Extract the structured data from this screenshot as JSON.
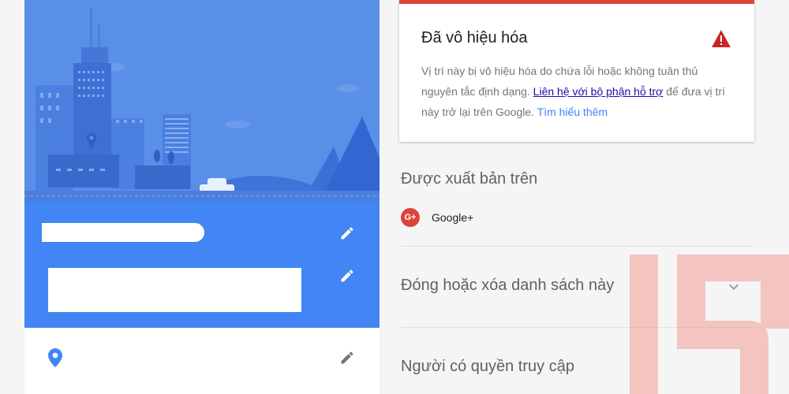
{
  "listing_card": {
    "name_redacted": true,
    "address_redacted": true
  },
  "alert": {
    "title": "Đã vô hiệu hóa",
    "body_prefix": "Vị trí này bị vô hiệu hóa do chứa lỗi hoặc không tuân thủ nguyên tắc định dạng. ",
    "support_link": "Liên hệ với bộ phận hỗ trợ",
    "body_suffix": " để đưa vị trí này trở lại trên Google. ",
    "learn_more_link": "Tìm hiểu thêm",
    "accent_color": "#db4437"
  },
  "published": {
    "title": "Được xuất bản trên",
    "platform_label": "Google+",
    "platform_icon": "G+"
  },
  "close_section": {
    "title": "Đóng hoặc xóa danh sách này",
    "icon": "chevron-down-icon"
  },
  "access_section": {
    "title": "Người có quyền truy cập"
  },
  "colors": {
    "primary_blue": "#4285f4",
    "hero_blue": "#5a8fe8",
    "alert_red": "#db4437"
  }
}
